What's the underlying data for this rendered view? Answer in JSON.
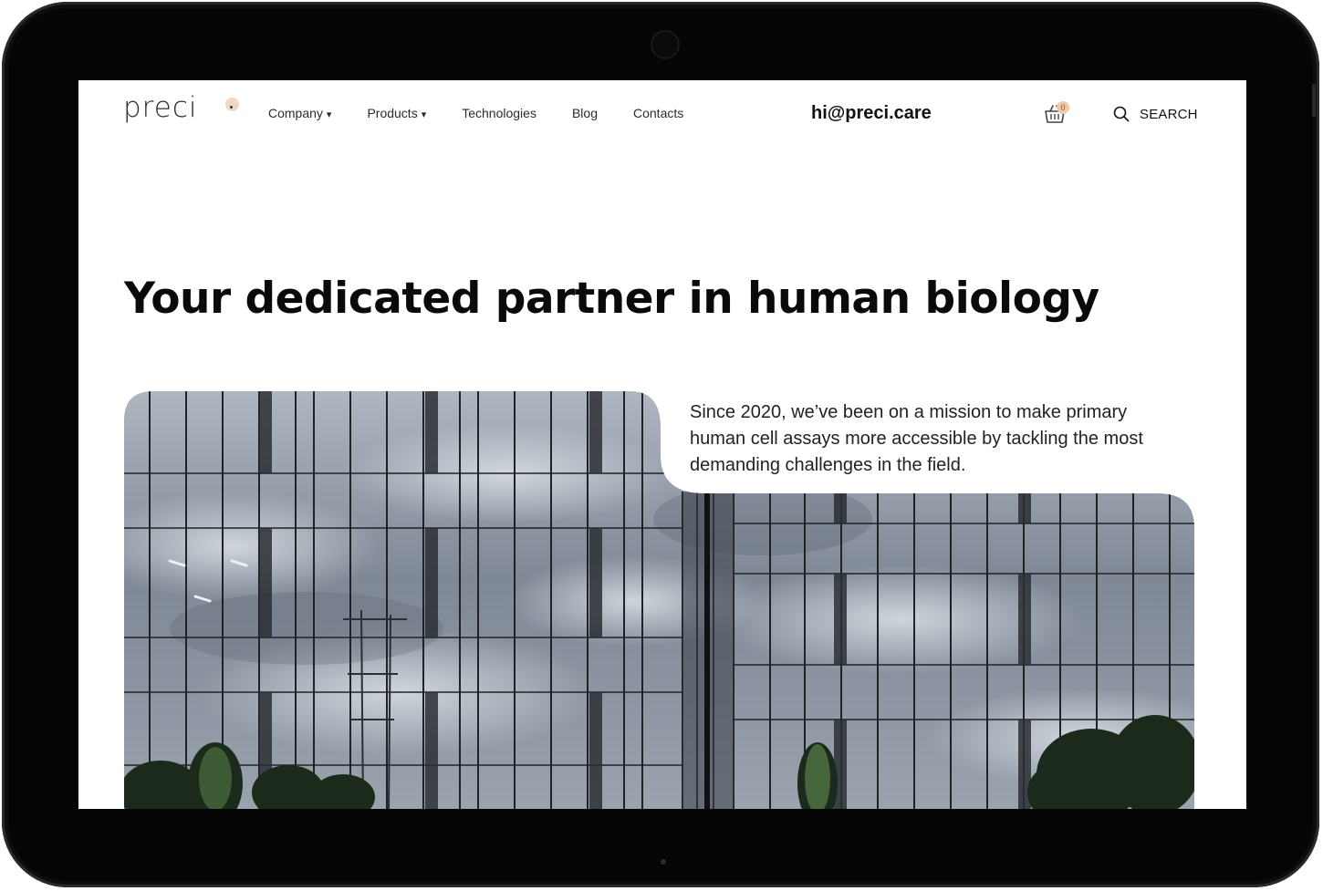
{
  "header": {
    "logo_text": "preci",
    "nav": [
      {
        "label": "Company",
        "dropdown": true
      },
      {
        "label": "Products",
        "dropdown": true
      },
      {
        "label": "Technologies",
        "dropdown": false
      },
      {
        "label": "Blog",
        "dropdown": false
      },
      {
        "label": "Contacts",
        "dropdown": false
      }
    ],
    "dropdown_glyph": "▾",
    "email": "hi@preci.care",
    "cart_count": "0",
    "search_label": "SEARCH"
  },
  "hero": {
    "title": "Your dedicated partner in human biology",
    "intro": "Since 2020, we’ve been on a mission to make primary human cell assays more accessible by tackling the most demanding challenges in the field."
  },
  "colors": {
    "accent_peach": "#f1d6c4",
    "text_dark": "#0a0a0a",
    "device_frame": "#050505"
  },
  "icons": [
    "cart-icon",
    "search-icon",
    "logo-dot"
  ]
}
